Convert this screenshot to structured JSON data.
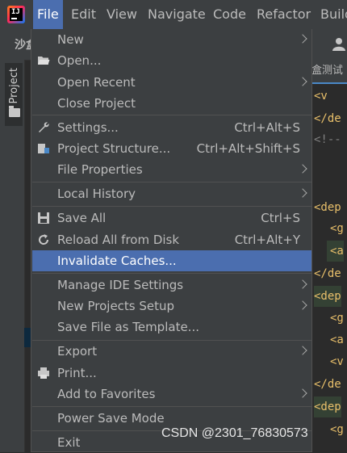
{
  "menubar": {
    "items": [
      "File",
      "Edit",
      "View",
      "Navigate",
      "Code",
      "Refactor",
      "Build"
    ]
  },
  "toolbar": {
    "sandbox_text": "沙盒"
  },
  "left_panel": {
    "project_tab": "Project"
  },
  "editor": {
    "tab_label": "盒测试",
    "lines": [
      "<v",
      "</de",
      "<!--",
      "<dep",
      "<g",
      "<a",
      "</de",
      "<dep",
      "<g",
      "<a",
      "<v",
      "</de",
      "<dep",
      "<g"
    ]
  },
  "file_menu": {
    "items": [
      {
        "label": "New",
        "shortcut": "",
        "submenu": true,
        "icon": ""
      },
      {
        "label": "Open...",
        "shortcut": "",
        "submenu": false,
        "icon": "folder-open-icon"
      },
      {
        "label": "Open Recent",
        "shortcut": "",
        "submenu": true,
        "icon": ""
      },
      {
        "label": "Close Project",
        "shortcut": "",
        "submenu": false,
        "icon": ""
      },
      {
        "label": "Settings...",
        "shortcut": "Ctrl+Alt+S",
        "submenu": false,
        "icon": "wrench-icon"
      },
      {
        "label": "Project Structure...",
        "shortcut": "Ctrl+Alt+Shift+S",
        "submenu": false,
        "icon": "project-structure-icon"
      },
      {
        "label": "File Properties",
        "shortcut": "",
        "submenu": true,
        "icon": ""
      },
      {
        "label": "Local History",
        "shortcut": "",
        "submenu": true,
        "icon": ""
      },
      {
        "label": "Save All",
        "shortcut": "Ctrl+S",
        "submenu": false,
        "icon": "save-icon"
      },
      {
        "label": "Reload All from Disk",
        "shortcut": "Ctrl+Alt+Y",
        "submenu": false,
        "icon": "reload-icon"
      },
      {
        "label": "Invalidate Caches...",
        "shortcut": "",
        "submenu": false,
        "icon": "",
        "selected": true
      },
      {
        "label": "Manage IDE Settings",
        "shortcut": "",
        "submenu": true,
        "icon": ""
      },
      {
        "label": "New Projects Setup",
        "shortcut": "",
        "submenu": true,
        "icon": ""
      },
      {
        "label": "Save File as Template...",
        "shortcut": "",
        "submenu": false,
        "icon": ""
      },
      {
        "label": "Export",
        "shortcut": "",
        "submenu": true,
        "icon": ""
      },
      {
        "label": "Print...",
        "shortcut": "",
        "submenu": false,
        "icon": "print-icon"
      },
      {
        "label": "Add to Favorites",
        "shortcut": "",
        "submenu": true,
        "icon": ""
      },
      {
        "label": "Power Save Mode",
        "shortcut": "",
        "submenu": false,
        "icon": ""
      },
      {
        "label": "Exit",
        "shortcut": "",
        "submenu": false,
        "icon": ""
      }
    ]
  },
  "watermark": "CSDN @2301_76830573",
  "colors": {
    "selection": "#4b6eaf",
    "menu_bg": "#3c3f41",
    "text": "#bbbbbb"
  }
}
